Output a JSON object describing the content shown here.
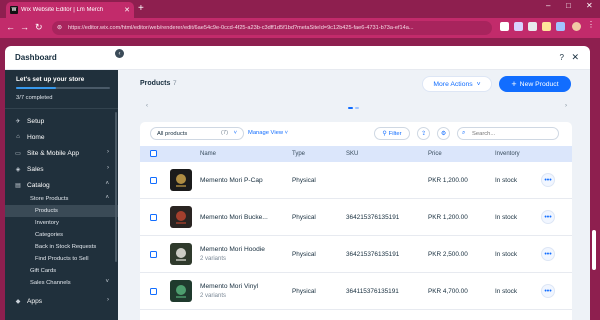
{
  "browser": {
    "tab_title": "Wix Website Editor | Lm Merch",
    "tab_favicon_text": "W",
    "url": "https://editor.wix.com/html/editor/web/renderer/edit/6ae54c9e-0ccd-4f25-a23b-c3dff1d5f1bd?metaSiteId=9c12b425-fae6-4731-b73a-ef14a...",
    "window_controls": [
      "–",
      "□",
      "✕"
    ]
  },
  "modal": {
    "title": "Dashboard",
    "help_icon": "question-icon",
    "close_icon": "close-icon"
  },
  "sidebar": {
    "setup_title": "Let's set up your store",
    "setup_status": "3/7 completed",
    "setup_progress": 0.43,
    "items": [
      {
        "label": "Setup",
        "icon": "rocket-icon",
        "glyph": "✈"
      },
      {
        "label": "Home",
        "icon": "home-icon",
        "glyph": "⌂"
      },
      {
        "label": "Site & Mobile App",
        "icon": "monitor-icon",
        "glyph": "▭"
      },
      {
        "label": "Sales",
        "icon": "tag-icon",
        "glyph": "◈"
      },
      {
        "label": "Catalog",
        "icon": "catalog-icon",
        "glyph": "▤"
      }
    ],
    "catalog_sub": {
      "store_products": "Store Products",
      "children": [
        "Products",
        "Inventory",
        "Categories",
        "Back in Stock Requests",
        "Find Products to Sell"
      ],
      "gift_cards": "Gift Cards",
      "sales_channels": "Sales Channels"
    },
    "apps": {
      "label": "Apps",
      "icon": "apps-icon",
      "glyph": "◆"
    }
  },
  "main": {
    "title": "Products",
    "count": "7",
    "more_actions": "More Actions",
    "new_product": "New Product",
    "toolbar": {
      "filter_select": "All products",
      "filter_count": "(7)",
      "manage_view": "Manage View",
      "filter_button": "Filter",
      "search_placeholder": "Search..."
    },
    "columns": [
      "Name",
      "Type",
      "SKU",
      "Price",
      "Inventory"
    ],
    "products": [
      {
        "name": "Memento Mori P-Cap",
        "variants": "",
        "type": "Physical",
        "sku": "",
        "price": "PKR 1,200.00",
        "inventory": "In stock",
        "thumb_bg": "#1b1b1b",
        "thumb_fg": "#c9a14a"
      },
      {
        "name": "Memento Mori Bucke...",
        "variants": "",
        "type": "Physical",
        "sku": "364215376135191",
        "price": "PKR 1,200.00",
        "inventory": "In stock",
        "thumb_bg": "#2a2422",
        "thumb_fg": "#b8442f"
      },
      {
        "name": "Memento Mori Hoodie",
        "variants": "2 variants",
        "type": "Physical",
        "sku": "364215376135191",
        "price": "PKR 2,500.00",
        "inventory": "In stock",
        "thumb_bg": "#2f3a2c",
        "thumb_fg": "#e8e6df"
      },
      {
        "name": "Memento Mori Vinyl",
        "variants": "2 variants",
        "type": "Physical",
        "sku": "364115376135191",
        "price": "PKR 4,700.00",
        "inventory": "In stock",
        "thumb_bg": "#1f3a2d",
        "thumb_fg": "#56b07a"
      }
    ]
  },
  "colors": {
    "browser_frame": "#8e1f4f",
    "tab_active": "#c22b6b",
    "sidebar_bg": "#20303c",
    "accent": "#116dff",
    "header_row": "#dbe6fb"
  }
}
